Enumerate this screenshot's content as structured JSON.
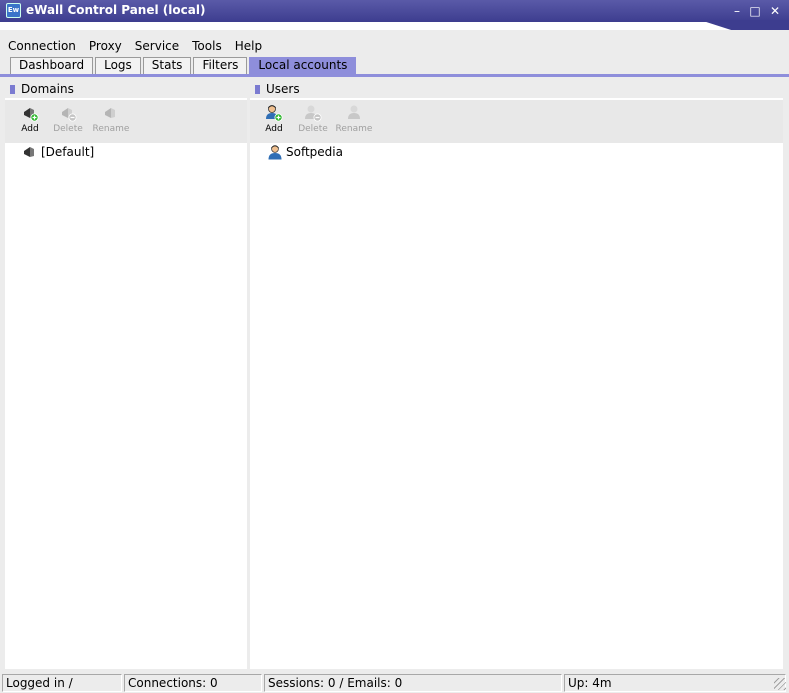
{
  "window": {
    "title": "eWall Control Panel (local)",
    "icon_text": "Ew"
  },
  "menu": [
    "Connection",
    "Proxy",
    "Service",
    "Tools",
    "Help"
  ],
  "tabs": [
    {
      "label": "Dashboard",
      "active": false
    },
    {
      "label": "Logs",
      "active": false
    },
    {
      "label": "Stats",
      "active": false
    },
    {
      "label": "Filters",
      "active": false
    },
    {
      "label": "Local accounts",
      "active": true
    }
  ],
  "domains": {
    "header": "Domains",
    "toolbar": {
      "add": "Add",
      "delete": "Delete",
      "rename": "Rename"
    },
    "items": [
      "[Default]"
    ]
  },
  "users": {
    "header": "Users",
    "toolbar": {
      "add": "Add",
      "delete": "Delete",
      "rename": "Rename"
    },
    "items": [
      "Softpedia"
    ]
  },
  "status": {
    "login": "Logged in /",
    "connections": "Connections: 0",
    "sessions": "Sessions: 0 / Emails: 0",
    "uptime": "Up: 4m"
  },
  "colors": {
    "title_bar": "#3d3d8f",
    "active_tab": "#8e8edb",
    "header_bullet": "#7b7bd1",
    "add_badge": "#2bb52b"
  }
}
